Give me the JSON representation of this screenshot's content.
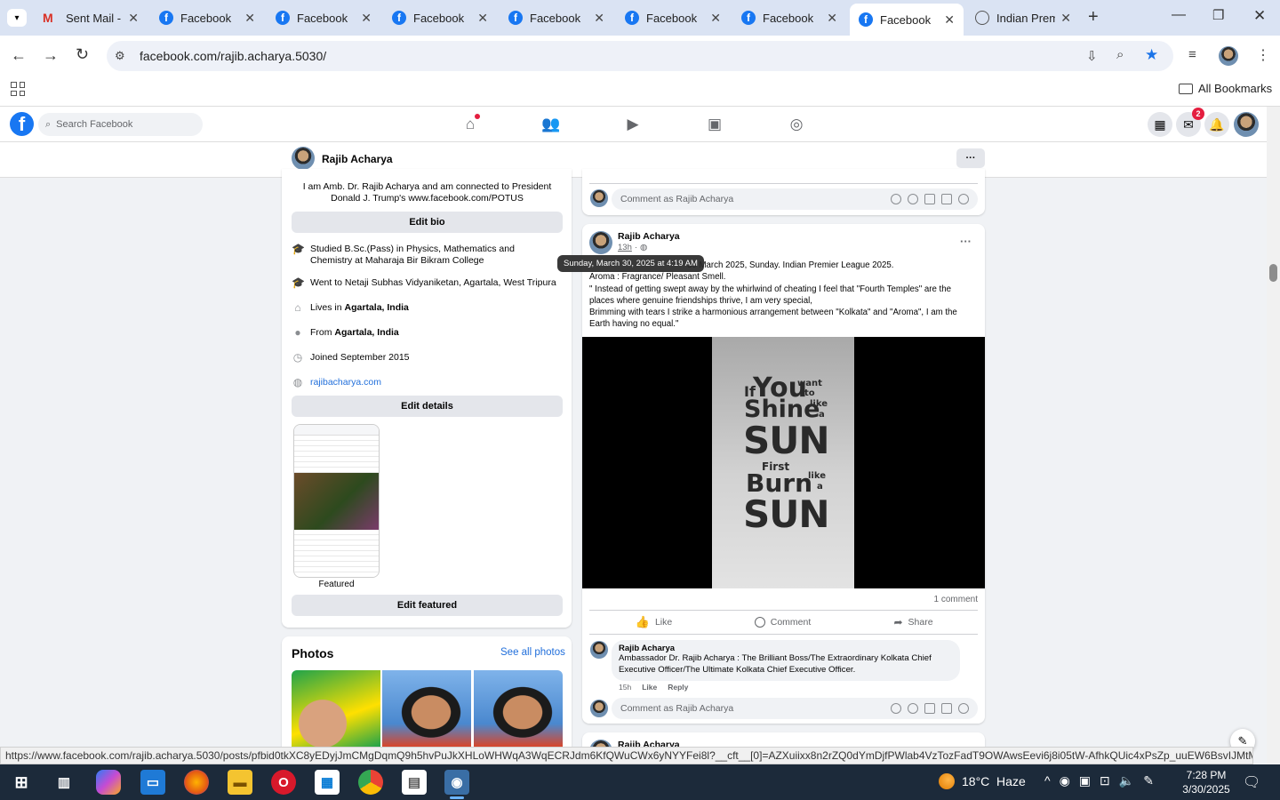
{
  "browser": {
    "tabs": [
      {
        "title": "Sent Mail -",
        "icon": "gmail-icon"
      },
      {
        "title": "Facebook",
        "icon": "facebook-icon"
      },
      {
        "title": "Facebook",
        "icon": "facebook-icon"
      },
      {
        "title": "Facebook",
        "icon": "facebook-icon"
      },
      {
        "title": "Facebook",
        "icon": "facebook-icon"
      },
      {
        "title": "Facebook",
        "icon": "facebook-icon"
      },
      {
        "title": "Facebook",
        "icon": "facebook-icon"
      },
      {
        "title": "Facebook",
        "icon": "facebook-icon",
        "active": true
      },
      {
        "title": "Indian Prem",
        "icon": "globe-icon"
      }
    ],
    "url": "facebook.com/rajib.acharya.5030/",
    "bookmarks_label": "All Bookmarks",
    "status_url": "https://www.facebook.com/rajib.acharya.5030/posts/pfbid0tkXC8yEDyjJmCMgDqmQ9h5hvPuJkXHLoWHWqA3WqECRJdm6KfQWuCWx6yNYYFei8l?__cft__[0]=AZXuiixx8n2rZQ0dYmDjfPWlab4VzTozFadT9OWAwsEevi6j8i05tW-AfhkQUic4xPsZp_uuEW6BsvIJMtMgHxt..."
  },
  "fb": {
    "search_placeholder": "Search Facebook",
    "messenger_badge": "2",
    "profile_name": "Rajib Acharya",
    "more": "···"
  },
  "intro": {
    "bio": "I am Amb. Dr. Rajib Acharya and am connected to President Donald J. Trump's www.facebook.com/POTUS",
    "edit_bio": "Edit bio",
    "studied": "Studied B.Sc.(Pass) in Physics, Mathematics and Chemistry at Maharaja Bir Bikram College",
    "went_to": "Went to Netaji Subhas Vidyaniketan, Agartala, West Tripura",
    "lives_prefix": "Lives in ",
    "lives_place": "Agartala, India",
    "from_prefix": "From ",
    "from_place": "Agartala, India",
    "joined": "Joined September 2015",
    "website": "rajibacharya.com",
    "edit_details": "Edit details",
    "featured_label": "Featured",
    "edit_featured": "Edit featured"
  },
  "photos": {
    "title": "Photos",
    "see_all": "See all photos"
  },
  "top_comment_bar": "Comment as Rajib Acharya",
  "post": {
    "author": "Rajib Acharya",
    "time": "13h",
    "tooltip": "Sunday, March 30, 2025 at 4:19 AM",
    "line1": "30 March 2025, Sunday. Indian Premier League 2025.",
    "line2": "Aroma : Fragrance/ Pleasant Smell.",
    "line3": "\" Instead of getting swept away by the whirlwind of cheating I feel that \"Fourth Temples\" are the places where genuine friendships thrive, I am very special,",
    "line4": "Brimming with tears I strike a harmonious arrangement between \"Kolkata\" and \"Aroma\", I am the Earth having no equal.\"",
    "image_text": {
      "w1": "You",
      "w2": "want",
      "w3": "to",
      "w4": "If",
      "w5": "Shine",
      "w6": "like",
      "w7": "a",
      "w8": "SUN",
      "w9": "First",
      "w10": "Burn",
      "w11": "like",
      "w12": "a",
      "w13": "SUN"
    },
    "comment_count": "1 comment",
    "like": "Like",
    "comment": "Comment",
    "share": "Share",
    "c_author": "Rajib Acharya",
    "c_text": "Ambassador Dr. Rajib Acharya : The Brilliant Boss/The Extraordinary Kolkata Chief Executive Officer/The Ultimate Kolkata Chief Executive Officer.",
    "c_time": "15h",
    "c_like": "Like",
    "c_reply": "Reply",
    "comment_as": "Comment as Rajib Acharya",
    "next_author": "Rajib Acharya"
  },
  "taskbar": {
    "weather": "18°C  Haze",
    "time": "7:28 PM",
    "date": "3/30/2025"
  },
  "colors": {
    "fb_blue": "#1877f2",
    "link": "#216fdb",
    "tab_bg": "#dae3f3",
    "taskbar": "#1c2a3a"
  }
}
